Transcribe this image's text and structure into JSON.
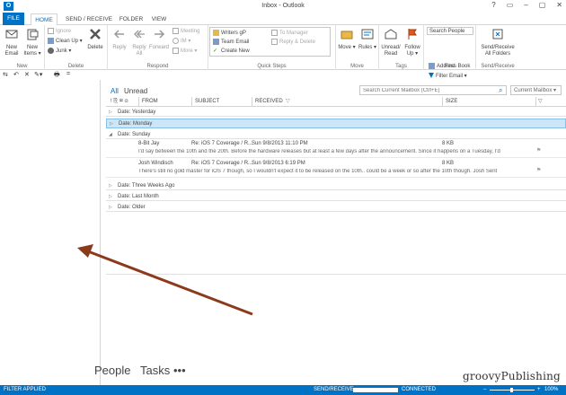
{
  "window": {
    "app_icon": "O",
    "title": "Inbox - Outlook",
    "controls": [
      "?",
      "▭",
      "–",
      "▢",
      "✕"
    ]
  },
  "tabs": [
    {
      "label": "FILE"
    },
    {
      "label": "HOME"
    },
    {
      "label": "SEND / RECEIVE"
    },
    {
      "label": "FOLDER"
    },
    {
      "label": "VIEW"
    }
  ],
  "ribbon": {
    "new_group": {
      "label": "New",
      "new_email": "New Email",
      "new_items": "New Items ▾"
    },
    "delete_group": {
      "label": "Delete",
      "ignore": "Ignore",
      "clean_up": "Clean Up ▾",
      "junk": "Junk ▾",
      "delete": "Delete"
    },
    "respond_group": {
      "label": "Respond",
      "reply": "Reply",
      "reply_all": "Reply All",
      "forward": "Forward",
      "meeting": "Meeting",
      "im": "IM ▾",
      "more": "More ▾"
    },
    "quicksteps_group": {
      "label": "Quick Steps",
      "writers": "Writers gP",
      "team_email": "Team Email",
      "create_new": "Create New",
      "to_manager": "To Manager",
      "reply_delete": "Reply & Delete"
    },
    "move_group": {
      "label": "Move",
      "move": "Move ▾",
      "rules": "Rules ▾"
    },
    "tags_group": {
      "label": "Tags",
      "unread_read": "Unread/ Read",
      "follow_up": "Follow Up ▾"
    },
    "find_group": {
      "label": "Find",
      "search_people": "Search People",
      "address_book": "Address Book",
      "filter_email": "Filter Email ▾"
    },
    "sendreceive_group": {
      "label": "Send/Receive",
      "send_receive_all": "Send/Receive All Folders"
    }
  },
  "quick_access": [
    "⇆",
    "↶",
    "✕",
    "✎▾",
    "🖶",
    "="
  ],
  "mailbox": {
    "filter_all": "All",
    "filter_unread": "Unread",
    "search_placeholder": "Search Current Mailbox (Ctrl+E)",
    "scope": "Current Mailbox",
    "columns": {
      "icons": "! ⎘ ✉ ⌀",
      "from": "FROM",
      "subject": "SUBJECT",
      "received": "RECEIVED",
      "size": "SIZE"
    }
  },
  "groups": [
    {
      "label": "Date: Yesterday",
      "arrow": "▷"
    },
    {
      "label": "Date: Monday",
      "arrow": "▷"
    },
    {
      "label": "Date: Sunday",
      "arrow": "◢"
    },
    {
      "label": "Date: Three Weeks Ago",
      "arrow": "▷"
    },
    {
      "label": "Date: Last Month",
      "arrow": "▷"
    },
    {
      "label": "Date: Older",
      "arrow": "▷"
    }
  ],
  "messages": [
    {
      "from": "8-Bit Jay",
      "subject": "Re: iOS 7 Coverage / R...",
      "received": "Sun 9/8/2013 11:10 PM",
      "size": "8 KB",
      "preview": "I'd say between the 10th and the 20th. Before the hardware releases but at least a few days after the announcement. Since it happens on a Tuesday, I'd"
    },
    {
      "from": "Josh Windisch",
      "subject": "Re: iOS 7 Coverage / R...",
      "received": "Sun 9/8/2013 6:19 PM",
      "size": "8 KB",
      "preview": "There's still no gold master for iOS 7 though, so I wouldn't expect it to be released on the 10th.. could be a week or so after the 10th though.  Josh  Sent"
    }
  ],
  "bottom_nav": {
    "people": "People",
    "tasks": "Tasks",
    "more": "•••"
  },
  "watermark": "groovyPublishing",
  "statusbar": {
    "filter": "FILTER APPLIED",
    "send_receive": "SEND/RECEIVE",
    "connected": "CONNECTED",
    "zoom_minus": "–",
    "zoom_plus": "+",
    "zoom": "100%"
  },
  "colors": {
    "accent": "#0072c6",
    "arrow": "#8b3a1c",
    "selected_group": "#cde6f7"
  }
}
